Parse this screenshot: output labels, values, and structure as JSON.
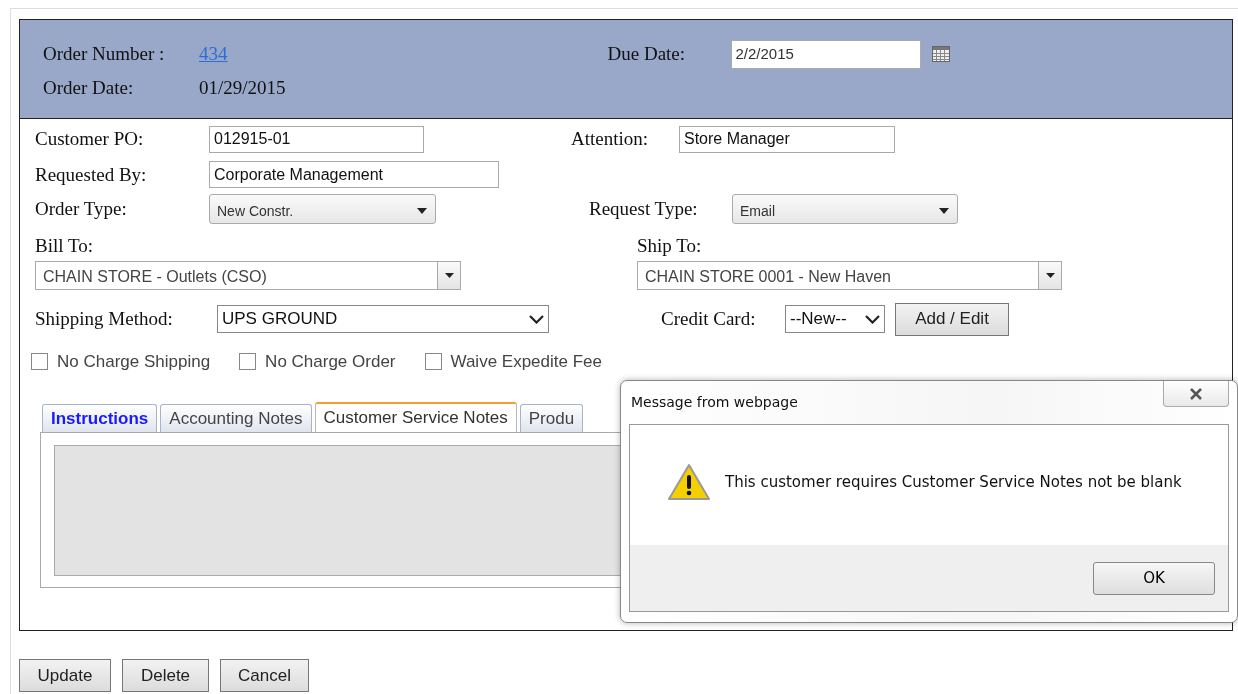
{
  "header": {
    "order_number_label": "Order Number :",
    "order_number": "434",
    "order_date_label": "Order Date:",
    "order_date": "01/29/2015",
    "due_date_label": "Due Date:",
    "due_date": "2/2/2015"
  },
  "customer_po": {
    "label": "Customer PO:",
    "value": "012915-01"
  },
  "attention": {
    "label": "Attention:",
    "value": "Store Manager"
  },
  "requested_by": {
    "label": "Requested By:",
    "value": "Corporate Management"
  },
  "order_type": {
    "label": "Order Type:",
    "value": "New Constr."
  },
  "request_type": {
    "label": "Request Type:",
    "value": "Email"
  },
  "bill_to": {
    "label": "Bill To:",
    "value": "CHAIN STORE - Outlets (CSO)"
  },
  "ship_to": {
    "label": "Ship To:",
    "value": "CHAIN STORE 0001 - New Haven"
  },
  "shipping_method": {
    "label": "Shipping Method:",
    "value": "UPS GROUND"
  },
  "credit_card": {
    "label": "Credit Card:",
    "value": "--New--",
    "button": "Add / Edit"
  },
  "options": [
    {
      "label": "No Charge Shipping",
      "checked": false
    },
    {
      "label": "No Charge Order",
      "checked": false
    },
    {
      "label": "Waive Expedite Fee",
      "checked": false
    }
  ],
  "tabs": [
    {
      "label": "Instructions",
      "selected": false,
      "highlighted": true
    },
    {
      "label": "Accounting Notes",
      "selected": false,
      "highlighted": false
    },
    {
      "label": "Customer Service Notes",
      "selected": true,
      "highlighted": false
    },
    {
      "label": "Produ",
      "selected": false,
      "highlighted": false
    }
  ],
  "buttons": [
    "Update",
    "Delete",
    "Cancel"
  ],
  "dialog": {
    "title": "Message from webpage",
    "message": "This customer requires Customer Service Notes not be blank",
    "button": "OK"
  }
}
